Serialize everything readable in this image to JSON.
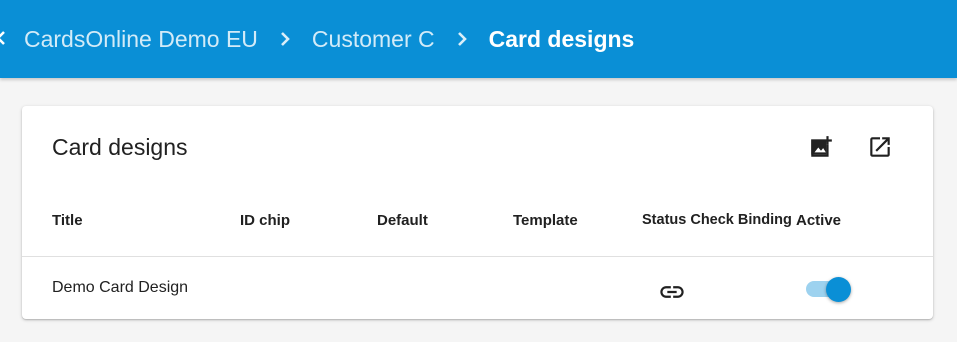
{
  "breadcrumb": {
    "items": [
      {
        "label": "CardsOnline Demo EU"
      },
      {
        "label": "Customer C"
      },
      {
        "label": "Card designs"
      }
    ]
  },
  "card": {
    "title": "Card designs",
    "actions": {
      "add_icon": "add-photo-icon",
      "open_icon": "open-in-new-icon"
    }
  },
  "table": {
    "columns": [
      "Title",
      "ID chip",
      "Default",
      "Template",
      "Status Check Binding",
      "Active"
    ],
    "rows": [
      {
        "title": "Demo Card Design",
        "id_chip": "",
        "default": "",
        "template": "",
        "status_check_binding_icon": "link-icon",
        "active": true
      }
    ]
  },
  "colors": {
    "brand": "#0a8fd6",
    "toggle_track": "#9dd2ef"
  }
}
